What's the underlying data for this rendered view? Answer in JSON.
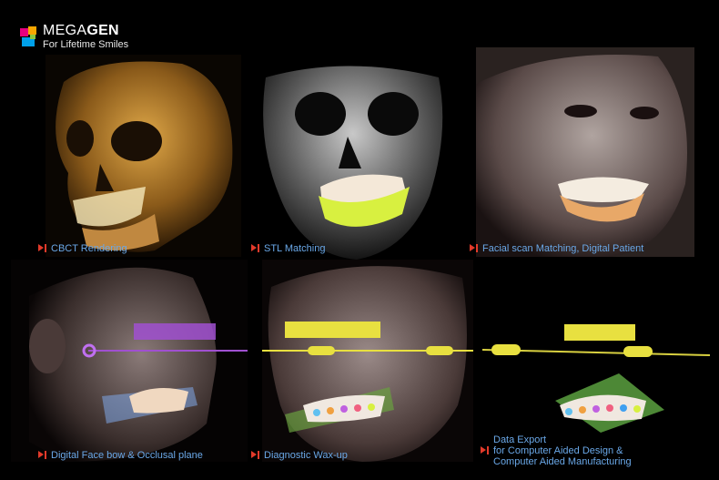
{
  "logo": {
    "brand_light": "MEGA",
    "brand_bold": "GEN",
    "tagline": "For Lifetime Smiles",
    "colors": [
      "#e6007e",
      "#f7a600",
      "#00a0e9",
      "#8cc63f"
    ]
  },
  "panels": [
    {
      "caption": "CBCT Rendering",
      "icon": "play-pause-icon"
    },
    {
      "caption": "STL Matching",
      "icon": "play-pause-icon"
    },
    {
      "caption": "Facial scan Matching, Digital Patient",
      "icon": "play-pause-icon"
    },
    {
      "caption": "Digital Face bow & Occlusal plane",
      "icon": "play-pause-icon"
    },
    {
      "caption": "Diagnostic Wax-up",
      "icon": "play-pause-icon"
    },
    {
      "caption_lines": [
        "Data Export",
        "for Computer Aided Design  &",
        "Computer Aided Manufacturing"
      ],
      "icon": "play-pause-icon"
    }
  ],
  "colors": {
    "caption": "#6aa8e8",
    "icon_red": "#e23a2a",
    "bone": "#b07a2a",
    "gum_guide": "#d8f040",
    "plane_yellow": "#e8e040",
    "plane_purple": "#a050d0",
    "plane_blue": "#80a8e8"
  }
}
